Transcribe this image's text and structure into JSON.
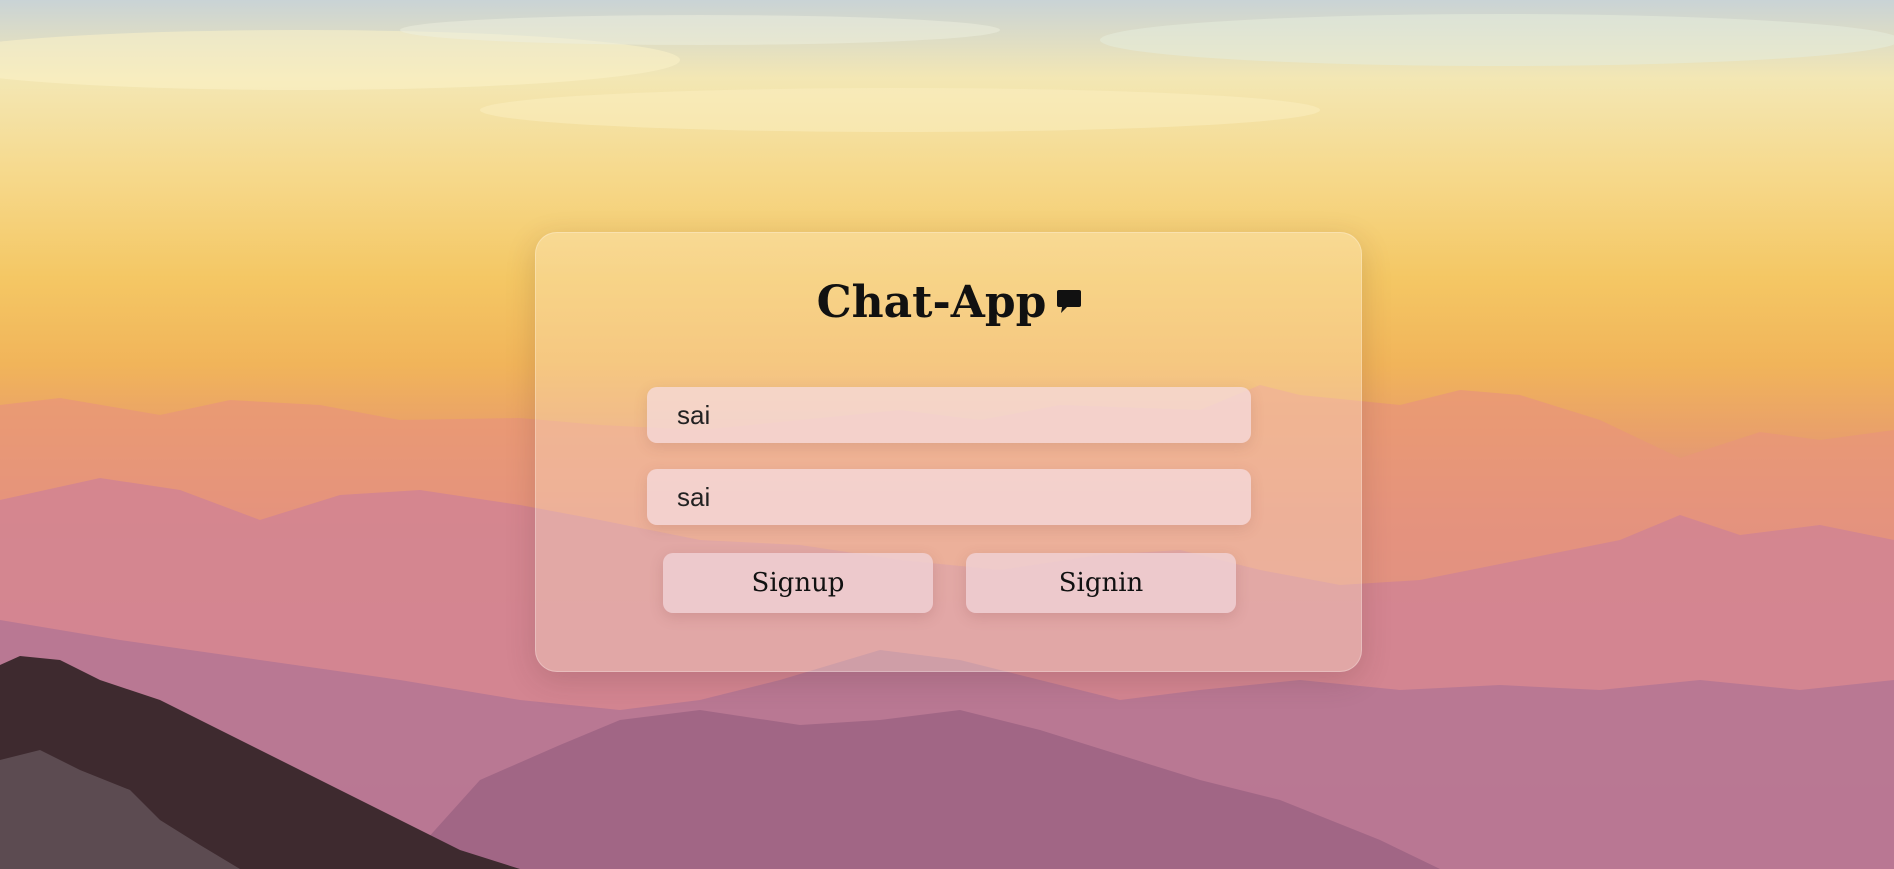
{
  "app": {
    "title": "Chat-App",
    "title_icon": "chat-bubble-icon"
  },
  "form": {
    "username_value": "sai",
    "password_value": "sai",
    "signup_label": "Signup",
    "signin_label": "Signin"
  },
  "colors": {
    "sky_top": "#c9d3d6",
    "sky_gold": "#f4c764",
    "mountain_pink": "#d98a8a",
    "mountain_purple": "#a8708f"
  }
}
